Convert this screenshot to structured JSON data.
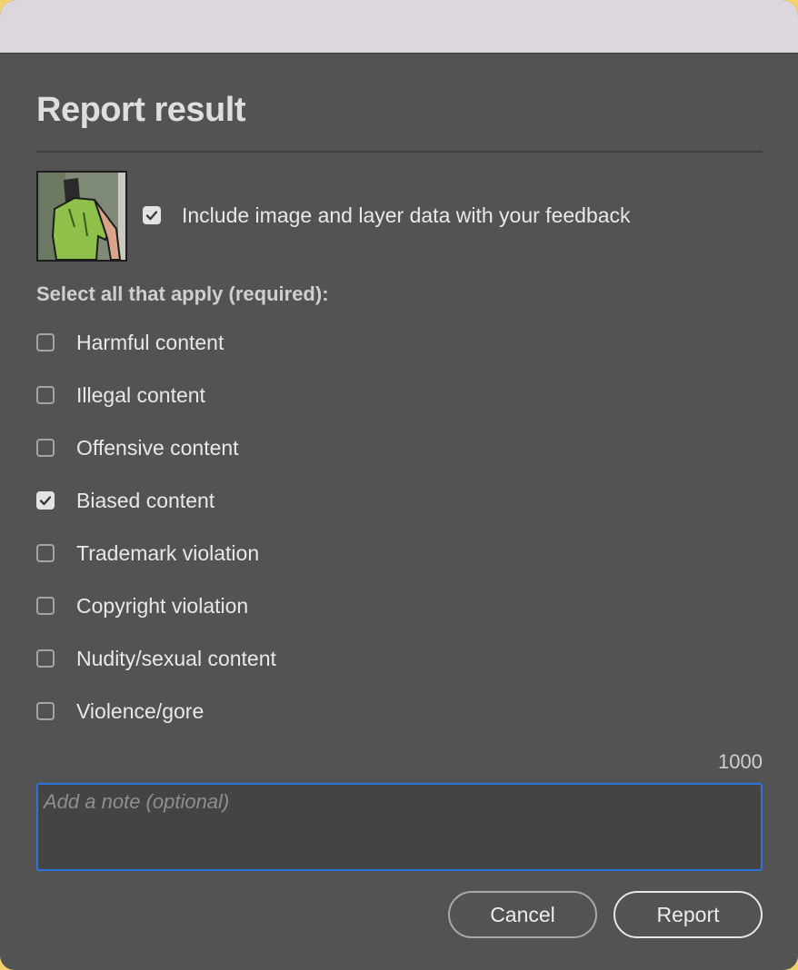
{
  "dialog": {
    "title": "Report result",
    "include_data_label": "Include image and layer data with your feedback",
    "include_data_checked": true,
    "section_label": "Select all that apply (required):",
    "options": [
      {
        "label": "Harmful content",
        "checked": false
      },
      {
        "label": "Illegal content",
        "checked": false
      },
      {
        "label": "Offensive content",
        "checked": false
      },
      {
        "label": "Biased content",
        "checked": true
      },
      {
        "label": "Trademark violation",
        "checked": false
      },
      {
        "label": "Copyright violation",
        "checked": false
      },
      {
        "label": "Nudity/sexual content",
        "checked": false
      },
      {
        "label": "Violence/gore",
        "checked": false
      }
    ],
    "note": {
      "counter": "1000",
      "placeholder": "Add a note (optional)",
      "value": ""
    },
    "buttons": {
      "cancel_label": "Cancel",
      "report_label": "Report"
    }
  },
  "colors": {
    "dialog_bg": "#535353",
    "focus_border": "#2b74e0",
    "text": "#e8e8e8"
  }
}
